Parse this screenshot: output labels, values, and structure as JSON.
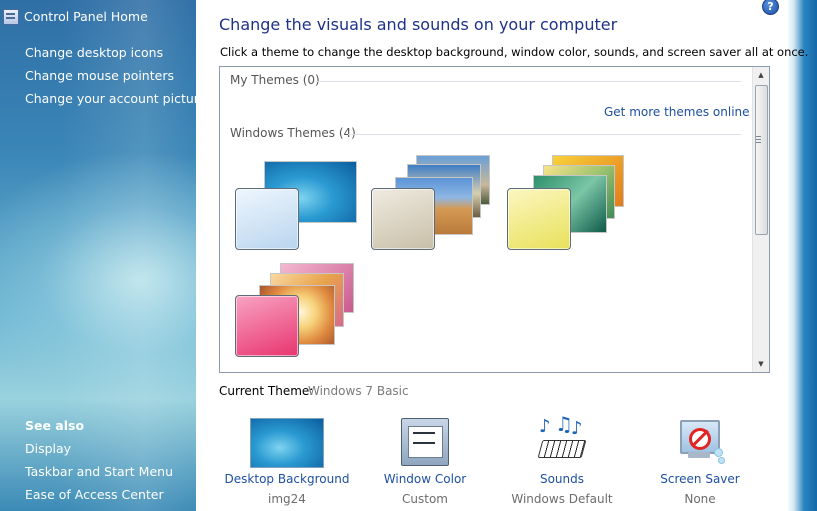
{
  "nav": {
    "home": "Control Panel Home",
    "links": [
      "Change desktop icons",
      "Change mouse pointers",
      "Change your account picture"
    ],
    "see_also_label": "See also",
    "see_also": [
      "Display",
      "Taskbar and Start Menu",
      "Ease of Access Center"
    ]
  },
  "help_icon": "?",
  "header": {
    "title": "Change the visuals and sounds on your computer",
    "subtitle": "Click a theme to change the desktop background, window color, sounds, and screen saver all at once."
  },
  "themes_box": {
    "my_themes_header": "My Themes (0)",
    "get_more_link": "Get more themes online",
    "windows_themes_header": "Windows Themes (4)",
    "windows_themes": [
      {
        "icon": "windows-7-theme",
        "swatch_color": "#cfe3f5"
      },
      {
        "icon": "landscapes-theme",
        "swatch_color": "#d8d0bc"
      },
      {
        "icon": "nature-theme",
        "swatch_color": "#f1ec7a"
      },
      {
        "icon": "flowers-theme",
        "swatch_color": "#f0709a"
      }
    ]
  },
  "current_theme": {
    "label": "Current Theme:",
    "value": "Windows 7 Basic"
  },
  "settings": [
    {
      "label": "Desktop Background",
      "value": "img24",
      "icon": "desktop-background-icon"
    },
    {
      "label": "Window Color",
      "value": "Custom",
      "icon": "window-color-icon"
    },
    {
      "label": "Sounds",
      "value": "Windows Default",
      "icon": "sounds-icon"
    },
    {
      "label": "Screen Saver",
      "value": "None",
      "icon": "screen-saver-icon"
    }
  ]
}
